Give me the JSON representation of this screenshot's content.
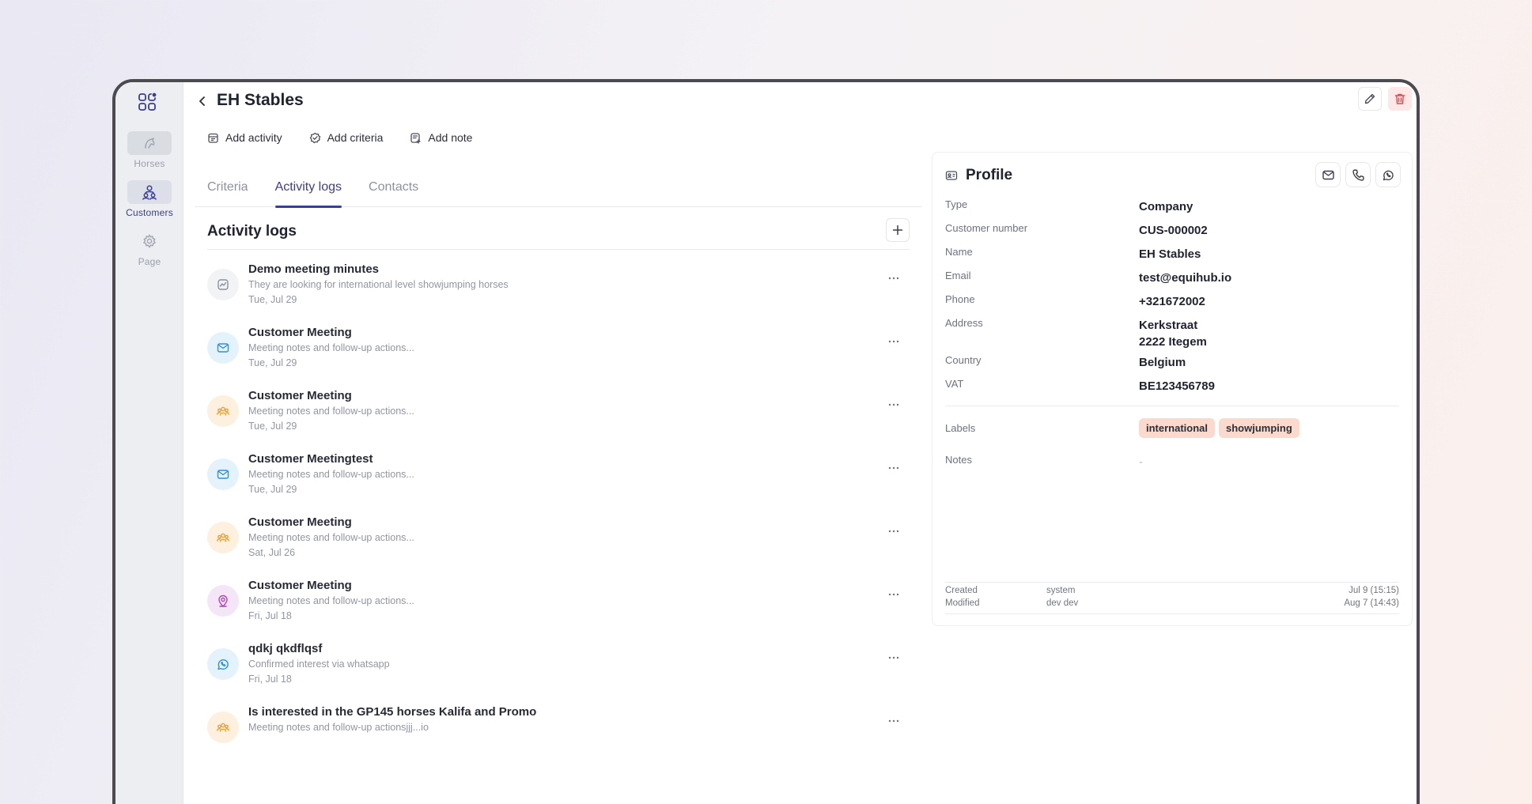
{
  "sidebar": {
    "items": [
      {
        "label": "Horses",
        "icon": "horse-icon"
      },
      {
        "label": "Customers",
        "icon": "customers-icon",
        "active": true
      },
      {
        "label": "Page",
        "icon": "gear-icon"
      }
    ]
  },
  "header": {
    "title": "EH Stables"
  },
  "quick_actions": {
    "add_activity": "Add activity",
    "add_criteria": "Add criteria",
    "add_note": "Add note"
  },
  "tabs": [
    {
      "label": "Criteria"
    },
    {
      "label": "Activity logs",
      "active": true
    },
    {
      "label": "Contacts"
    }
  ],
  "activity_logs": {
    "title": "Activity logs",
    "items": [
      {
        "title": "Demo meeting minutes",
        "description": "They are looking for international level showjumping horses",
        "date": "Tue, Jul 29",
        "icon": "chart-icon",
        "icon_bg": "#f2f3f5",
        "icon_color": "#8b919c"
      },
      {
        "title": "Customer Meeting",
        "description": "Meeting notes and follow-up actions...",
        "date": "Tue, Jul 29",
        "icon": "mail-icon",
        "icon_bg": "#e4f2fc",
        "icon_color": "#2f8fd8"
      },
      {
        "title": "Customer Meeting",
        "description": "Meeting notes and follow-up actions...",
        "date": "Tue, Jul 29",
        "icon": "group-icon",
        "icon_bg": "#fdf0df",
        "icon_color": "#e8a23c"
      },
      {
        "title": "Customer Meetingtest",
        "description": "Meeting notes and follow-up actions...",
        "date": "Tue, Jul 29",
        "icon": "mail-icon",
        "icon_bg": "#e4f2fc",
        "icon_color": "#2f8fd8"
      },
      {
        "title": "Customer Meeting",
        "description": "Meeting notes and follow-up actions...",
        "date": "Sat, Jul 26",
        "icon": "group-icon",
        "icon_bg": "#fdf0df",
        "icon_color": "#e8a23c"
      },
      {
        "title": "Customer Meeting",
        "description": "Meeting notes and follow-up actions...",
        "date": "Fri, Jul 18",
        "icon": "location-pin-icon",
        "icon_bg": "#f5e6f7",
        "icon_color": "#b342b8"
      },
      {
        "title": "qdkj qkdflqsf",
        "description": "Confirmed interest via whatsapp",
        "date": "Fri, Jul 18",
        "icon": "whatsapp-icon",
        "icon_bg": "#e4f2fc",
        "icon_color": "#2f8fd8"
      },
      {
        "title": "Is interested in the GP145 horses Kalifa and Promo",
        "description": "Meeting notes and follow-up actionsjjj...io",
        "date": "",
        "icon": "group-icon",
        "icon_bg": "#fdf0df",
        "icon_color": "#e8a23c"
      }
    ]
  },
  "profile": {
    "title": "Profile",
    "fields": {
      "type": {
        "label": "Type",
        "value": "Company"
      },
      "customer_number": {
        "label": "Customer number",
        "value": "CUS-000002"
      },
      "name": {
        "label": "Name",
        "value": "EH Stables"
      },
      "email": {
        "label": "Email",
        "value": "test@equihub.io"
      },
      "phone": {
        "label": "Phone",
        "value": "+321672002"
      },
      "address": {
        "label": "Address",
        "line1": "Kerkstraat",
        "line2": "2222 Itegem"
      },
      "country": {
        "label": "Country",
        "value": "Belgium"
      },
      "vat": {
        "label": "VAT",
        "value": "BE123456789"
      }
    },
    "labels": {
      "label": "Labels",
      "tags": [
        "international",
        "showjumping"
      ]
    },
    "notes": {
      "label": "Notes",
      "value": "-"
    },
    "meta": {
      "created": {
        "label": "Created",
        "user": "system",
        "date": "Jul 9  (15:15)"
      },
      "modified": {
        "label": "Modified",
        "user": "dev dev",
        "date": "Aug 7  (14:43)"
      }
    }
  },
  "colors": {
    "accent": "#3b3f8f",
    "danger": "#e5484d",
    "tag_bg": "#fbd9cd"
  }
}
